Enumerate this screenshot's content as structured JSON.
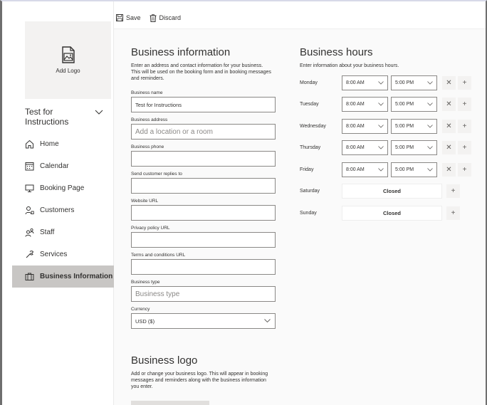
{
  "toolbar": {
    "save_label": "Save",
    "discard_label": "Discard"
  },
  "sidebar": {
    "add_logo": "Add Logo",
    "business_name": "Test for Instructions",
    "items": [
      {
        "label": "Home",
        "icon": "home-icon"
      },
      {
        "label": "Calendar",
        "icon": "calendar-icon"
      },
      {
        "label": "Booking Page",
        "icon": "monitor-icon"
      },
      {
        "label": "Customers",
        "icon": "customers-icon"
      },
      {
        "label": "Staff",
        "icon": "staff-icon"
      },
      {
        "label": "Services",
        "icon": "services-icon"
      },
      {
        "label": "Business Information",
        "icon": "briefcase-icon",
        "active": true
      }
    ]
  },
  "info": {
    "title": "Business information",
    "description": "Enter an address and contact information for your business. This will be used on the booking form and in booking messages and reminders.",
    "fields": {
      "name_label": "Business name",
      "name_value": "Test for Instructions",
      "address_label": "Business address",
      "address_placeholder": "Add a location or a room",
      "phone_label": "Business phone",
      "phone_value": "",
      "replies_label": "Send customer replies to",
      "replies_value": "",
      "website_label": "Website URL",
      "website_value": "",
      "privacy_label": "Privacy policy URL",
      "privacy_value": "",
      "terms_label": "Terms and conditions URL",
      "terms_value": "",
      "type_label": "Business type",
      "type_placeholder": "Business type",
      "currency_label": "Currency",
      "currency_value": "USD ($)"
    }
  },
  "hours": {
    "title": "Business hours",
    "description": "Enter information about your business hours.",
    "days": [
      {
        "day": "Monday",
        "open": "8:00 AM",
        "close": "5:00 PM"
      },
      {
        "day": "Tuesday",
        "open": "8:00 AM",
        "close": "5:00 PM"
      },
      {
        "day": "Wednesday",
        "open": "8:00 AM",
        "close": "5:00 PM"
      },
      {
        "day": "Thursday",
        "open": "8:00 AM",
        "close": "5:00 PM"
      },
      {
        "day": "Friday",
        "open": "8:00 AM",
        "close": "5:00 PM"
      },
      {
        "day": "Saturday",
        "status": "Closed"
      },
      {
        "day": "Sunday",
        "status": "Closed"
      }
    ]
  },
  "logo": {
    "title": "Business logo",
    "description": "Add or change your business logo. This will appear in booking messages and reminders along with the business information you enter."
  }
}
